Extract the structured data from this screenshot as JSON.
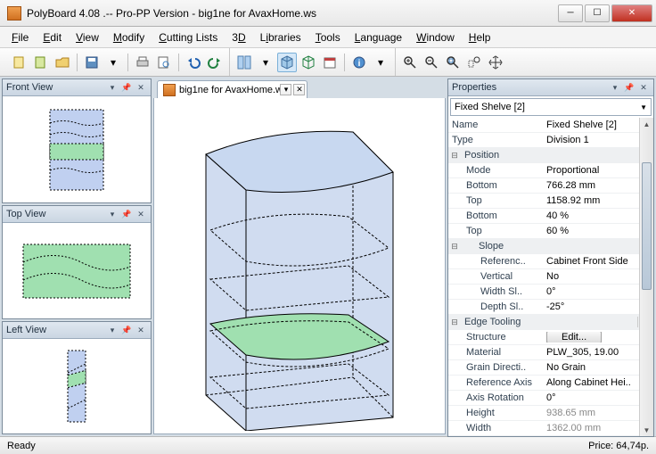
{
  "window": {
    "title": "PolyBoard 4.08 .-- Pro-PP Version - big1ne for AvaxHome.ws"
  },
  "menu": [
    "File",
    "Edit",
    "View",
    "Modify",
    "Cutting Lists",
    "3D",
    "Libraries",
    "Tools",
    "Language",
    "Window",
    "Help"
  ],
  "panels": {
    "front": "Front View",
    "top": "Top View",
    "left": "Left View",
    "props": "Properties"
  },
  "tab": {
    "label": "big1ne for AvaxHome.ws"
  },
  "propCombo": "Fixed Shelve [2]",
  "props": [
    {
      "t": "row",
      "name": "Name",
      "val": "Fixed Shelve [2]"
    },
    {
      "t": "row",
      "name": "Type",
      "val": "Division 1"
    },
    {
      "t": "grp",
      "name": "Position",
      "lvl": 0
    },
    {
      "t": "row",
      "name": "Mode",
      "val": "Proportional",
      "lvl": 1
    },
    {
      "t": "row",
      "name": "Bottom",
      "val": "766.28 mm",
      "lvl": 1
    },
    {
      "t": "row",
      "name": "Top",
      "val": "1158.92 mm",
      "lvl": 1
    },
    {
      "t": "row",
      "name": "Bottom",
      "val": "40 %",
      "lvl": 1
    },
    {
      "t": "row",
      "name": "Top",
      "val": "60 %",
      "lvl": 1
    },
    {
      "t": "grp",
      "name": "Slope",
      "lvl": 1
    },
    {
      "t": "row",
      "name": "Referenc..",
      "val": "Cabinet Front Side",
      "lvl": 2
    },
    {
      "t": "row",
      "name": "Vertical",
      "val": "No",
      "lvl": 2
    },
    {
      "t": "row",
      "name": "Width Sl..",
      "val": "0°",
      "lvl": 2
    },
    {
      "t": "row",
      "name": "Depth Sl..",
      "val": "-25°",
      "lvl": 2
    },
    {
      "t": "grp",
      "name": "Edge Tooling",
      "lvl": 0,
      "dots": true
    },
    {
      "t": "row",
      "name": "Structure",
      "val": "Edit...",
      "lvl": 1,
      "btn": true
    },
    {
      "t": "row",
      "name": "Material",
      "val": "PLW_305, 19.00",
      "lvl": 1
    },
    {
      "t": "row",
      "name": "Grain Directi..",
      "val": "No Grain",
      "lvl": 1
    },
    {
      "t": "row",
      "name": "Reference Axis",
      "val": "Along Cabinet Hei..",
      "lvl": 1
    },
    {
      "t": "row",
      "name": "Axis Rotation",
      "val": "0°",
      "lvl": 1
    },
    {
      "t": "row",
      "name": "Height",
      "val": "938.65 mm",
      "lvl": 1,
      "dim": true
    },
    {
      "t": "row",
      "name": "Width",
      "val": "1362.00 mm",
      "lvl": 1,
      "dim": true
    }
  ],
  "status": {
    "left": "Ready",
    "right": "Price: 64,74p."
  }
}
